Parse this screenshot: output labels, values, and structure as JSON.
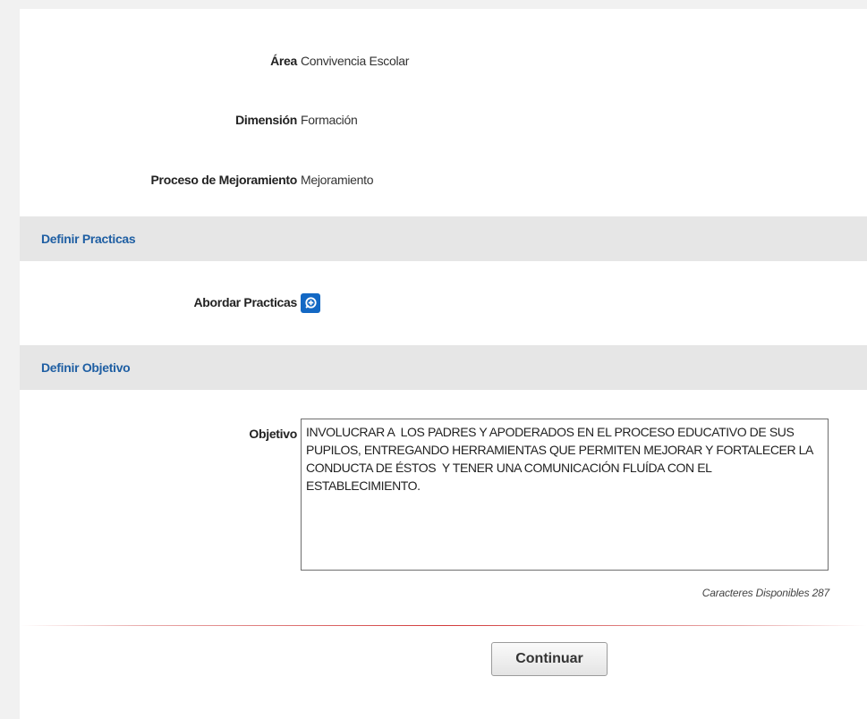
{
  "fields": {
    "area": {
      "label": "Área",
      "value": "Convivencia Escolar"
    },
    "dimension": {
      "label": "Dimensión",
      "value": "Formación"
    },
    "proceso": {
      "label": "Proceso de Mejoramiento",
      "value": "Mejoramiento"
    }
  },
  "sections": {
    "practicas": {
      "title": "Definir Practicas",
      "abordar_label": "Abordar Practicas"
    },
    "objetivo": {
      "title": "Definir Objetivo",
      "label": "Objetivo",
      "text": "INVOLUCRAR A  LOS PADRES Y APODERADOS EN EL PROCESO EDUCATIVO DE SUS PUPILOS, ENTREGANDO HERRAMIENTAS QUE PERMITEN MEJORAR Y FORTALECER LA CONDUCTA DE ÉSTOS  Y TENER UNA COMUNICACIÓN FLUÍDA CON EL ESTABLECIMIENTO.",
      "char_count": "Caracteres Disponibles 287"
    }
  },
  "actions": {
    "continue_label": "Continuar"
  },
  "icons": {
    "add": "add-circle-icon"
  },
  "colors": {
    "accent": "#1368c4",
    "section_title": "#1f5fa3",
    "divider": "#d23b3b"
  }
}
